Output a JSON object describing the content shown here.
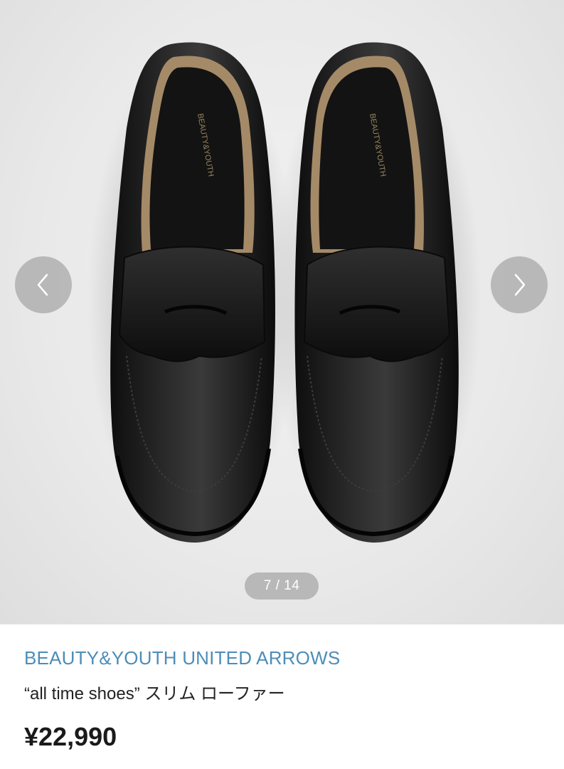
{
  "gallery": {
    "counter_current": "7",
    "counter_total": "14",
    "counter_text": "7 / 14",
    "image_insole_text": "BEAUTY&YOUTH",
    "prev_icon": "chevron-left-icon",
    "next_icon": "chevron-right-icon"
  },
  "product": {
    "brand": "BEAUTY&YOUTH UNITED ARROWS",
    "title": "“all time shoes” スリム ローファー",
    "price": "¥22,990"
  },
  "colors": {
    "brand_link": "#4d8db8",
    "counter_bg": "#afafaf",
    "nav_button_bg": "#aaaaaa"
  }
}
